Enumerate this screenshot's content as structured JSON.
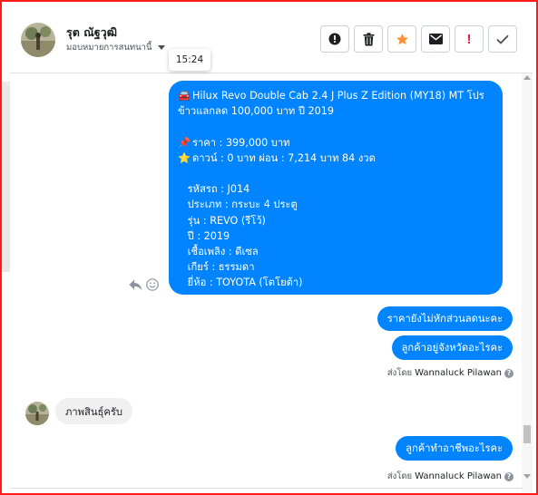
{
  "colors": {
    "accent": "#0084ff",
    "frame": "#ff1a1a",
    "star": "#f7923a",
    "alert_red": "#e41e3f"
  },
  "header": {
    "name": "รุต ณัฐวุฒิ",
    "assign_label": "มอบหมายการสนทนานี้",
    "avatar": "contact-avatar",
    "tools": [
      {
        "icon": "info-icon",
        "label": "!"
      },
      {
        "icon": "trash-icon"
      },
      {
        "icon": "star-icon"
      },
      {
        "icon": "mail-icon"
      },
      {
        "icon": "exclamation-icon",
        "label": "!"
      },
      {
        "icon": "check-icon"
      }
    ]
  },
  "tooltip": {
    "time": "15:24"
  },
  "messages": {
    "big": {
      "lines": [
        "Hilux Revo Double Cab 2.4 J Plus Z Edition (MY18) MT โปร",
        "ข้าวแลกลด 100,000 บาท ปี 2019",
        "",
        "ราคา : 399,000 บาท",
        "ดาวน์ : 0 บาท ผ่อน : 7,214 บาท 84 งวด",
        "",
        "   รหัสรถ : J014",
        "   ประเภท : กระบะ 4 ประตู",
        "   รุ่น : REVO (รีโว้)",
        "   ปี : 2019",
        "   เชื้อเพลิง : ดีเซล",
        "   เกียร์ : ธรรมดา",
        "   ยี่ห้อ : TOYOTA (โตโยต้า)"
      ],
      "icons": [
        "car-emoji-icon",
        "pin-emoji-icon",
        "star-emoji-icon"
      ]
    },
    "m1": "ราคายังไม่หักส่วนลดนะคะ",
    "m2": "ลูกค้าอยู่จังหวัดอะไรคะ",
    "sent1": {
      "prefix": "ส่งโดย",
      "name": "Wannaluck Pilawan"
    },
    "incoming": "ภาพสินธุ์ครับ",
    "m3": "ลูกค้าทำอาชีพอะไรคะ",
    "sent2": {
      "prefix": "ส่งโดย",
      "name": "Wannaluck Pilawan"
    }
  }
}
